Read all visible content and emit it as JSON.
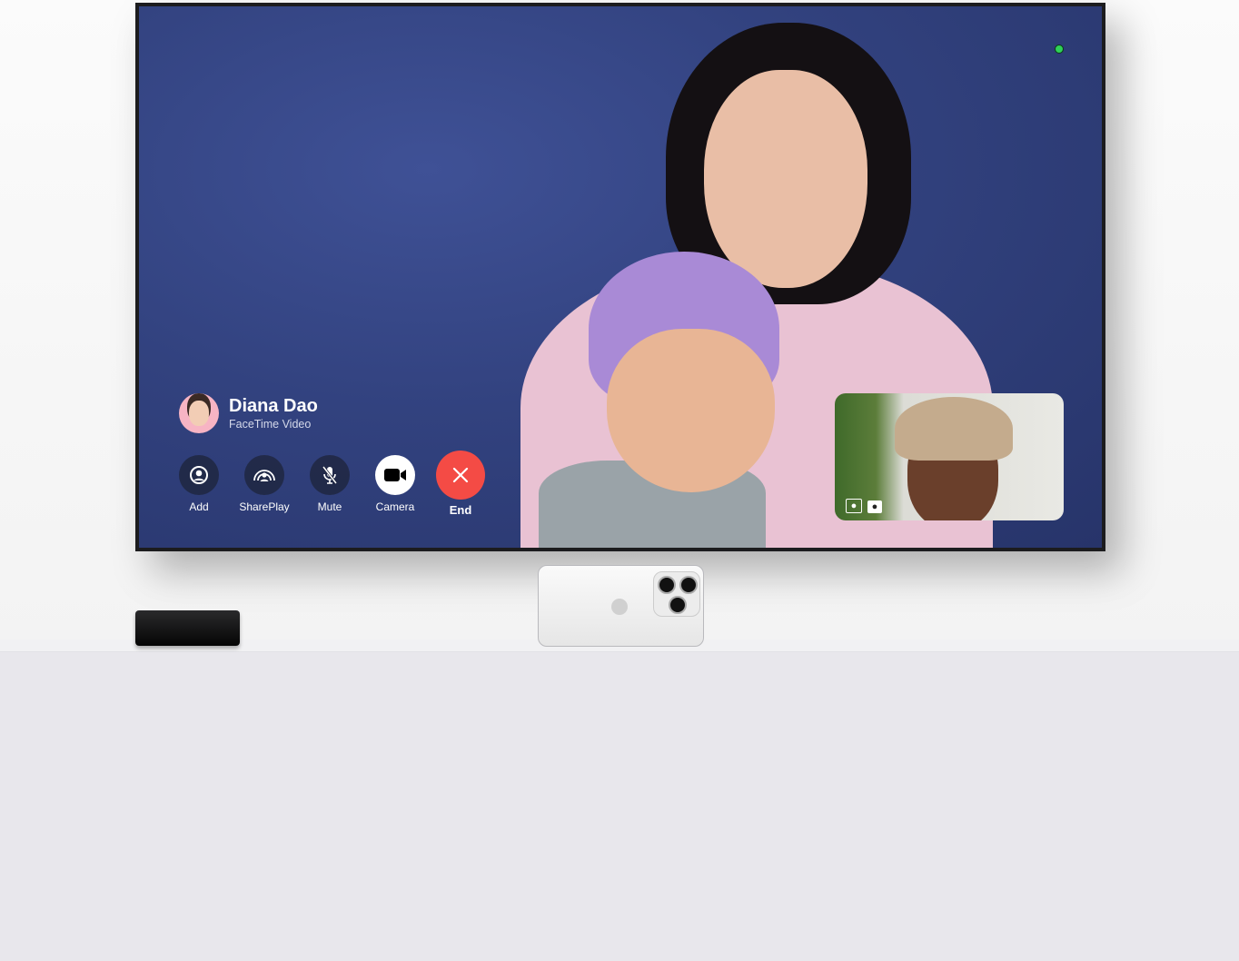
{
  "call": {
    "caller_name": "Diana Dao",
    "call_type": "FaceTime Video",
    "status_indicator_color": "#2fd158"
  },
  "controls": [
    {
      "label": "Add",
      "icon": "person-circle-icon"
    },
    {
      "label": "SharePlay",
      "icon": "shareplay-icon"
    },
    {
      "label": "Mute",
      "icon": "mic-slash-icon"
    },
    {
      "label": "Camera",
      "icon": "video-camera-icon"
    },
    {
      "label": "End",
      "icon": "close-x-icon",
      "color": "#f44b45"
    }
  ],
  "self_view": {
    "icons": [
      "center-stage-icon",
      "portrait-icon"
    ]
  }
}
